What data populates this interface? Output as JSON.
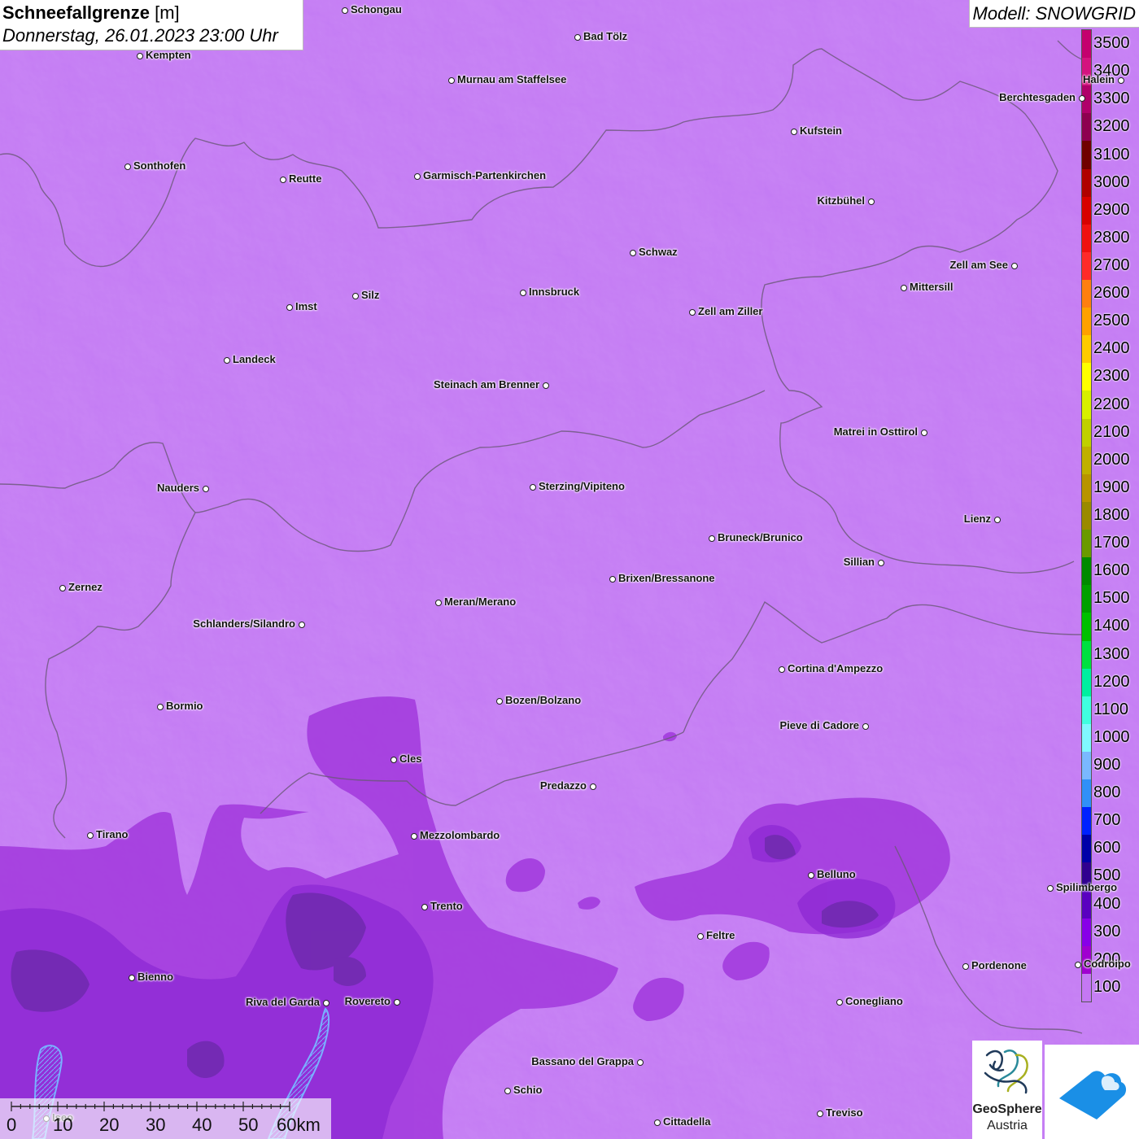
{
  "title": {
    "main": "Schneefallgrenze",
    "unit": "[m]",
    "datetime": "Donnerstag, 26.01.2023 23:00 Uhr"
  },
  "model": "Modell: SNOWGRID",
  "legend": {
    "labels": [
      "3500",
      "3400",
      "3300",
      "3200",
      "3100",
      "3000",
      "2900",
      "2800",
      "2700",
      "2600",
      "2500",
      "2400",
      "2300",
      "2200",
      "2100",
      "2000",
      "1900",
      "1800",
      "1700",
      "1600",
      "1500",
      "1400",
      "1300",
      "1200",
      "1100",
      "1000",
      "900",
      "800",
      "700",
      "600",
      "500",
      "400",
      "300",
      "200",
      "100"
    ],
    "colors": [
      "#c4006e",
      "#d4137f",
      "#b0006a",
      "#8e0050",
      "#700000",
      "#b00000",
      "#d80000",
      "#f01010",
      "#ff2a2a",
      "#ff7f0f",
      "#ffa100",
      "#ffcb00",
      "#ffff00",
      "#d8f000",
      "#c0d000",
      "#c0b000",
      "#b89400",
      "#9a8a00",
      "#6a9a00",
      "#008a00",
      "#00a000",
      "#00c000",
      "#00e040",
      "#00f0a0",
      "#40ffe0",
      "#80f8ff",
      "#7ab8ff",
      "#3090f8",
      "#0020ff",
      "#0000a8",
      "#300090",
      "#5a00c0",
      "#8800e8",
      "#a000d0",
      "#c478f3"
    ]
  },
  "cities": [
    {
      "name": "Schongau"
    },
    {
      "name": "Bad Tölz"
    },
    {
      "name": "Kempten"
    },
    {
      "name": "Murnau am Staffelsee"
    },
    {
      "name": "Halein"
    },
    {
      "name": "Berchtesgaden"
    },
    {
      "name": "Kufstein"
    },
    {
      "name": "Sonthofen"
    },
    {
      "name": "Reutte"
    },
    {
      "name": "Garmisch-Partenkirchen"
    },
    {
      "name": "Kitzbühel"
    },
    {
      "name": "Schwaz"
    },
    {
      "name": "Zell am See"
    },
    {
      "name": "Innsbruck"
    },
    {
      "name": "Mittersill"
    },
    {
      "name": "Silz"
    },
    {
      "name": "Imst"
    },
    {
      "name": "Zell am Ziller"
    },
    {
      "name": "Landeck"
    },
    {
      "name": "Steinach am Brenner"
    },
    {
      "name": "Matrei in Osttirol"
    },
    {
      "name": "Nauders"
    },
    {
      "name": "Sterzing/Vipiteno"
    },
    {
      "name": "Lienz"
    },
    {
      "name": "Bruneck/Brunico"
    },
    {
      "name": "Sillian"
    },
    {
      "name": "Brixen/Bressanone"
    },
    {
      "name": "Zernez"
    },
    {
      "name": "Meran/Merano"
    },
    {
      "name": "Schlanders/Silandro"
    },
    {
      "name": "Cortina d'Ampezzo"
    },
    {
      "name": "Bozen/Bolzano"
    },
    {
      "name": "Bormio"
    },
    {
      "name": "Pieve di Cadore"
    },
    {
      "name": "Cles"
    },
    {
      "name": "Predazzo"
    },
    {
      "name": "Tirano"
    },
    {
      "name": "Mezzolombardo"
    },
    {
      "name": "Belluno"
    },
    {
      "name": "Spilimbergo"
    },
    {
      "name": "Trento"
    },
    {
      "name": "Feltre"
    },
    {
      "name": "Pordenone"
    },
    {
      "name": "Codroipo"
    },
    {
      "name": "Bienno"
    },
    {
      "name": "Riva del Garda"
    },
    {
      "name": "Rovereto"
    },
    {
      "name": "Conegliano"
    },
    {
      "name": "Bassano del Grappa"
    },
    {
      "name": "Schio"
    },
    {
      "name": "Treviso"
    },
    {
      "name": "Cittadella"
    },
    {
      "name": "Iseo"
    }
  ],
  "scale": {
    "labels": [
      "0",
      "10",
      "20",
      "30",
      "40",
      "50",
      "60km"
    ]
  },
  "logo": {
    "line1": "GeoSphere",
    "line2": "Austria"
  }
}
